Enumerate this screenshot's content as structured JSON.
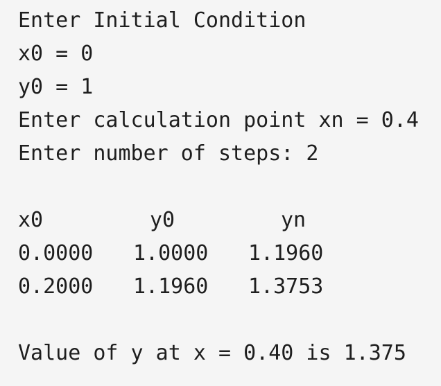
{
  "console": {
    "lines": [
      "Enter Initial Condition",
      "x0 = 0",
      "y0 = 1",
      "Enter calculation point xn = 0.4",
      "Enter number of steps: 2"
    ],
    "table": {
      "headers": [
        "x0",
        "y0",
        "yn"
      ],
      "rows": [
        [
          "0.0000",
          "1.0000",
          "1.1960"
        ],
        [
          "0.2000",
          "1.1960",
          "1.3753"
        ]
      ]
    },
    "result": "Value of y at x = 0.40 is 1.375"
  }
}
